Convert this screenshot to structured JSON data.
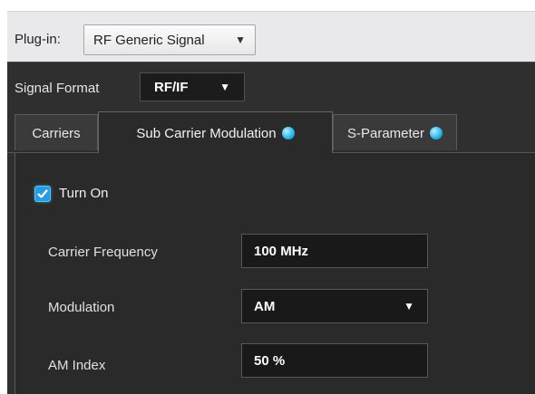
{
  "plugin": {
    "label": "Plug-in:",
    "selected": "RF Generic Signal"
  },
  "signal_format": {
    "label": "Signal Format",
    "selected": "RF/IF"
  },
  "tabs": [
    {
      "label": "Carriers",
      "active": false,
      "indicator": false
    },
    {
      "label": "Sub Carrier Modulation",
      "active": true,
      "indicator": true
    },
    {
      "label": "S-Parameter",
      "active": false,
      "indicator": true
    }
  ],
  "turn_on": {
    "label": "Turn On",
    "checked": true
  },
  "fields": {
    "carrier_frequency": {
      "label": "Carrier Frequency",
      "value": "100 MHz"
    },
    "modulation": {
      "label": "Modulation",
      "selected": "AM"
    },
    "am_index": {
      "label": "AM Index",
      "value": "50 %"
    }
  },
  "icons": {
    "dropdown": "caret-down-icon",
    "status_dot": "status-dot-icon",
    "check": "checkmark-icon"
  },
  "colors": {
    "accent": "#29b2ea",
    "dark_bg": "#2f2f2f",
    "light_bar": "#e9e9ec"
  }
}
